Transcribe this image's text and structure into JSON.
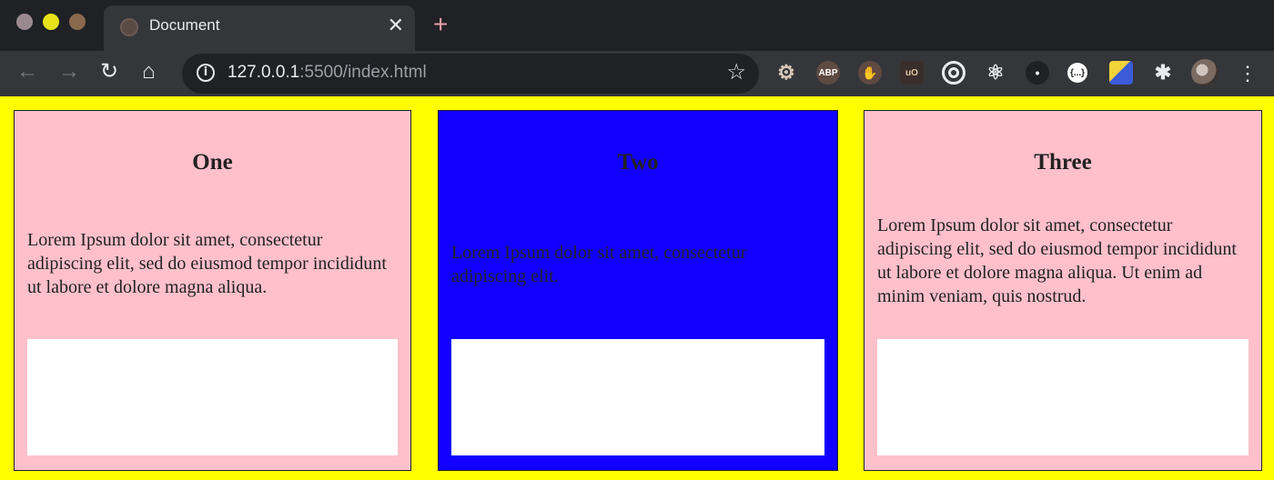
{
  "browser": {
    "tab": {
      "title": "Document"
    },
    "new_tab_label": "+",
    "omnibox": {
      "url_host": "127.0.0.1",
      "url_rest": ":5500/index.html"
    },
    "extensions": [
      "settings-gear-icon",
      "adblock-plus-icon",
      "hand-stop-icon",
      "ublock-origin-icon",
      "target-icon",
      "react-devtools-icon",
      "dot-extension-icon",
      "json-viewer-icon",
      "cube-extension-icon",
      "puzzle-extensions-icon"
    ],
    "ext_abp_label": "ABP",
    "ext_json_label": "{...}",
    "ext_ublock_label": "uO"
  },
  "page": {
    "background": "#ffff00",
    "cards": [
      {
        "heading": "One",
        "text": "Lorem Ipsum dolor sit amet, consectetur adipiscing elit, sed do eiusmod tempor incididunt ut labore et dolore magna aliqua.",
        "background": "#ffc0cb"
      },
      {
        "heading": "Two",
        "text": "Lorem Ipsum dolor sit amet, consectetur adipiscing elit.",
        "background": "#1100ff"
      },
      {
        "heading": "Three",
        "text": "Lorem Ipsum dolor sit amet, consectetur adipiscing elit, sed do eiusmod tempor incididunt ut labore et dolore magna aliqua. Ut enim ad minim veniam, quis nostrud.",
        "background": "#ffc0cb"
      }
    ]
  }
}
